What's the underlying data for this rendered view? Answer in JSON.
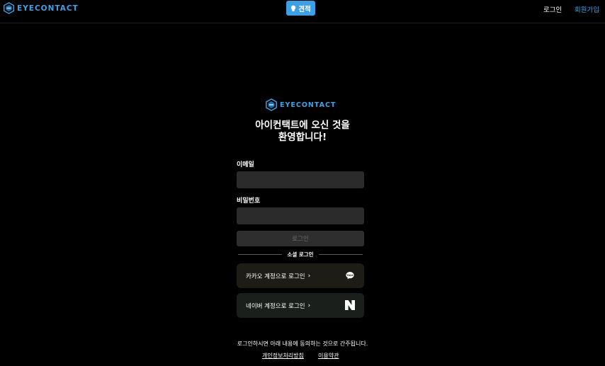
{
  "header": {
    "logo_text": "EYECONTACT",
    "quote_button": "견적",
    "login": "로그인",
    "signup": "회원가입"
  },
  "main": {
    "logo_text": "EYECONTACT",
    "welcome_line1": "아이컨택트에 오신 것을",
    "welcome_line2": "환영합니다!",
    "email_label": "이메일",
    "email_value": "",
    "password_label": "비밀번호",
    "password_value": "",
    "login_button": "로그인",
    "social_login_label": "소셜 로그인",
    "kakao_button": "카카오 계정으로 로그인",
    "naver_button": "네이버 계정으로 로그인",
    "agreement_text": "로그인하시면 아래 내용에 동의하는 것으로 간주됩니다.",
    "privacy_link": "개인정보처리방침",
    "terms_link": "이용약관"
  },
  "colors": {
    "accent": "#3ea3e6",
    "background": "#000000",
    "input_bg": "#2b2b2b"
  },
  "icons": {
    "logo": "eyecontact-logo-icon",
    "quote": "lightbulb-icon",
    "kakao": "kakao-talk-icon",
    "naver": "naver-n-icon",
    "chevron": "chevron-right-icon"
  }
}
